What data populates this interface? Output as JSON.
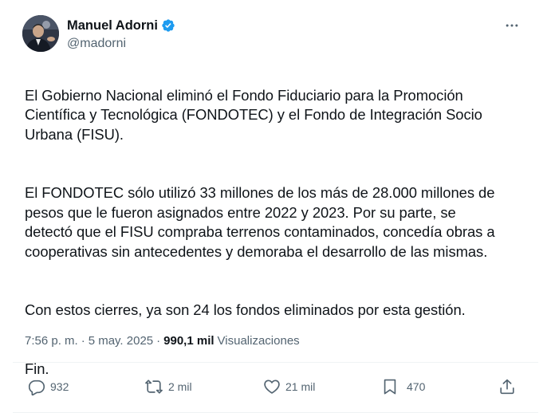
{
  "author": {
    "name": "Manuel Adorni",
    "handle": "@madorni",
    "verified": true
  },
  "tweet": {
    "paragraphs": [
      "El Gobierno Nacional eliminó el Fondo Fiduciario para la Promoción Científica y Tecnológica (FONDOTEC) y el Fondo de Integración Socio Urbana (FISU).",
      "El FONDOTEC sólo utilizó 33 millones de los más de 28.000 millones de pesos que le fueron asignados entre 2022 y 2023. Por su parte, se detectó que el FISU compraba terrenos contaminados, concedía obras a cooperativas sin antecedentes y demoraba el desarrollo de las mismas.",
      "Con estos cierres, ya son 24 los fondos eliminados por esta gestión.",
      "Fin."
    ],
    "time": "7:56 p. m.",
    "date": "5 may. 2025",
    "separator": "·",
    "views_count": "990,1 mil",
    "views_label": "Visualizaciones"
  },
  "actions": {
    "replies": "932",
    "reposts": "2 mil",
    "likes": "21 mil",
    "bookmarks": "470"
  },
  "icons": {
    "more": "more-icon",
    "reply": "reply-icon",
    "repost": "repost-icon",
    "like": "heart-icon",
    "bookmark": "bookmark-icon",
    "share": "share-icon",
    "verified": "verified-badge-icon"
  },
  "colors": {
    "text": "#0f1419",
    "secondary": "#536471",
    "verified": "#1d9bf0",
    "divider": "#eff3f4"
  }
}
